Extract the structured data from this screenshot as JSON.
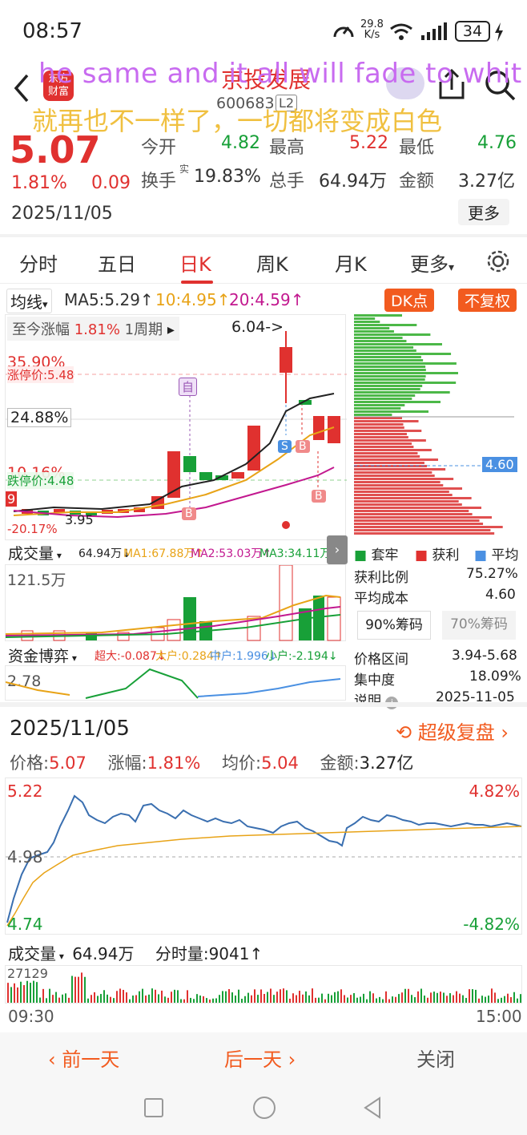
{
  "status": {
    "time": "08:57",
    "net_speed_top": "29.8",
    "net_speed_bottom": "K/s",
    "battery": "34"
  },
  "header": {
    "stock_name": "京投发展",
    "code": "600683",
    "l2": "L2"
  },
  "overlay": {
    "en": "he same and it all will fade to whit",
    "zh": "就再也不一样了，一切都将变成白色"
  },
  "quote": {
    "price": "5.07",
    "pct": "1.81%",
    "change": "0.09",
    "date": "2025/11/05",
    "open_label": "今开",
    "open": "4.82",
    "high_label": "最高",
    "high": "5.22",
    "low_label": "最低",
    "low": "4.76",
    "turnover_label": "换手",
    "turnover_sup": "实",
    "turnover": "19.83%",
    "vol_label": "总手",
    "vol": "64.94万",
    "amount_label": "金额",
    "amount": "3.27亿",
    "more": "更多"
  },
  "tabs": [
    "分时",
    "五日",
    "日K",
    "周K",
    "月K",
    "更多"
  ],
  "ma": {
    "select": "均线",
    "ma5": "MA5:5.29↑",
    "ma10": "10:4.95↑",
    "ma20": "20:4.59↑",
    "dk": "DK点",
    "fq": "不复权"
  },
  "kline": {
    "since_label": "至今涨幅",
    "since_val": "1.81%",
    "period": "1周期",
    "pct_top": "35.90%",
    "limit_up": "涨停价:5.48",
    "pct_mid": "24.88%",
    "pct_low": "10.16%",
    "limit_down": "跌停价:4.48",
    "low_price": "3.95",
    "pct_bottom": "-20.17%",
    "high_mark": "6.04->",
    "mark_self": "自",
    "mark_s": "S",
    "mark_b": "B",
    "digit": "9"
  },
  "chart_data": {
    "type": "table",
    "candles_close_trend": "rising",
    "chips": {
      "price_line": "4.60"
    }
  },
  "volume": {
    "label": "成交量",
    "vol": "64.94万↓",
    "ma1": "MA1:67.88万↑",
    "ma2": "MA2:53.03万↑",
    "ma3": "MA3:34.11万↑",
    "max": "121.5万"
  },
  "fund": {
    "label": "资金博弈",
    "super": "超大:-0.087↓",
    "big": "大户:0.284↑",
    "mid": "中户:1.996↓",
    "small": "小户:-2.194↓",
    "val": "2.78"
  },
  "chips": {
    "legend_trap": "套牢",
    "legend_profit": "获利",
    "legend_avg": "平均",
    "ratio_label": "获利比例",
    "ratio": "75.27%",
    "cost_label": "平均成本",
    "cost": "4.60",
    "tab90": "90%筹码",
    "tab70": "70%筹码",
    "range_label": "价格区间",
    "range": "3.94-5.68",
    "conc_label": "集中度",
    "conc": "18.09%",
    "note_label": "说明",
    "note_date": "2025-11-05",
    "price_tag": "4.60"
  },
  "intraday": {
    "date": "2025/11/05",
    "replay": "超级复盘",
    "price_label": "价格:",
    "price": "5.07",
    "pct_label": "涨幅:",
    "pct": "1.81%",
    "avg_label": "均价:",
    "avg": "5.04",
    "amount_label": "金额:",
    "amount": "3.27亿",
    "y_high": "5.22",
    "y_mid": "4.98",
    "y_low": "4.74",
    "pct_high": "4.82%",
    "pct_low": "-4.82%",
    "vol_label": "成交量",
    "vol": "64.94万",
    "tick_label": "分时量:9041↑",
    "vol_max": "27129",
    "t_start": "09:30",
    "t_end": "15:00"
  },
  "nav": {
    "prev": "前一天",
    "next": "后一天",
    "close": "关闭"
  }
}
